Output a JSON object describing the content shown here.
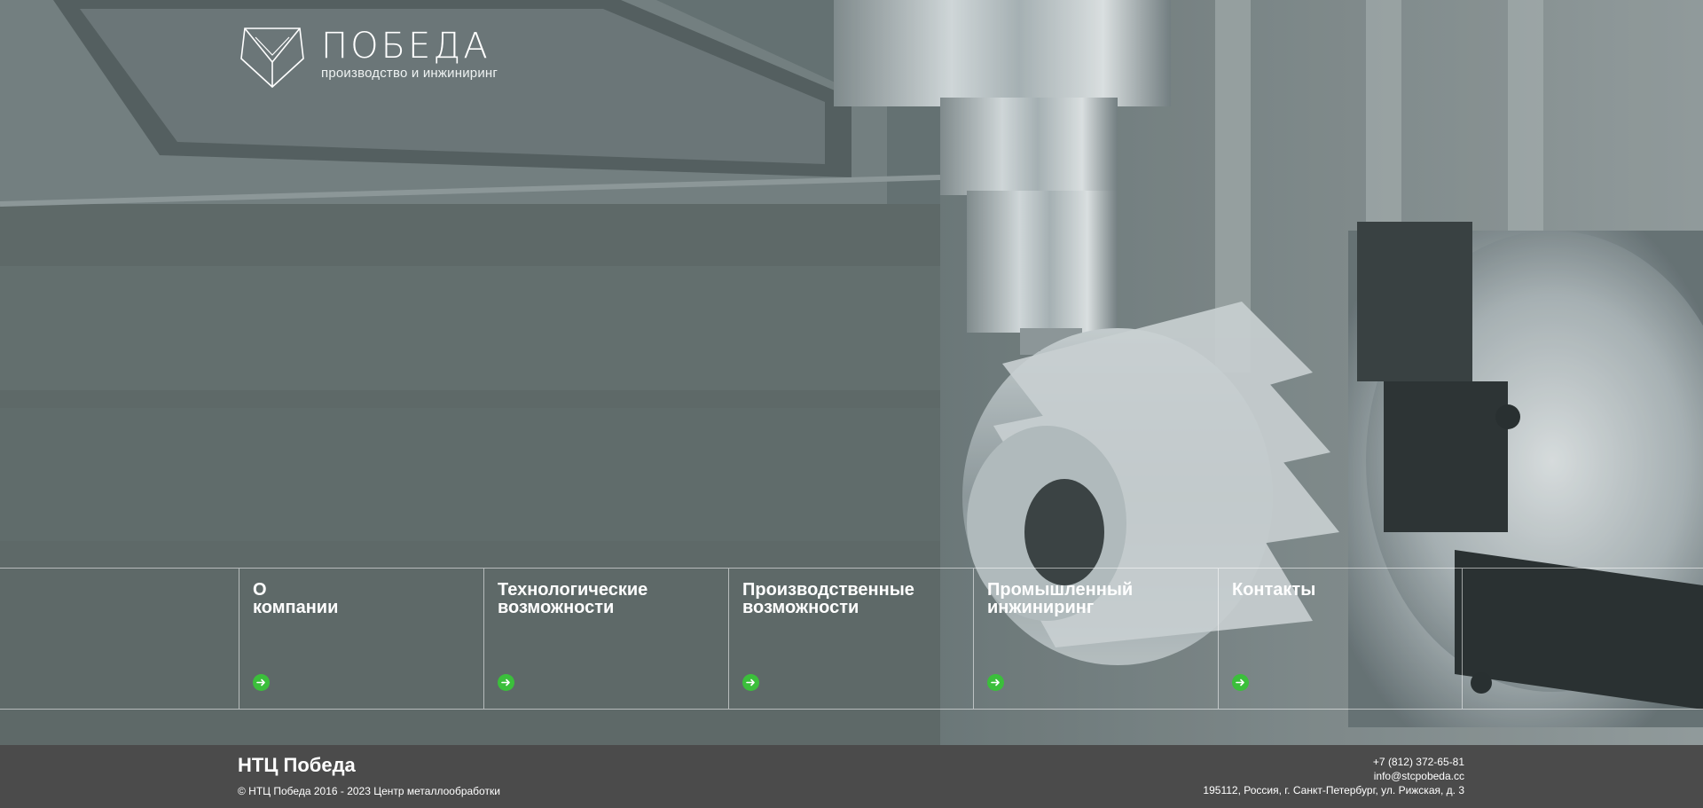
{
  "brand": {
    "logo_name": "ПОБЕДА",
    "tagline": "производство и инжиниринг",
    "logo_icon": "shield-logo-icon"
  },
  "nav": {
    "items": [
      {
        "label": "О\nкомпании",
        "icon": "arrow-right-icon"
      },
      {
        "label": "Технологические\nвозможности",
        "icon": "arrow-right-icon"
      },
      {
        "label": "Производственные\nвозможности",
        "icon": "arrow-right-icon"
      },
      {
        "label": "Промышленный\nинжиниринг",
        "icon": "arrow-right-icon"
      },
      {
        "label": "Контакты",
        "icon": "arrow-right-icon"
      }
    ],
    "accent_color": "#3bbf3b"
  },
  "footer": {
    "company": "НТЦ Победа",
    "copyright": "© НТЦ Победа 2016 - 2023 Центр металлообработки",
    "phone": "+7 (812) 372-65-81",
    "email": "info@stcpobeda.cc",
    "address": "195112, Россия, г. Санкт-Петербург, ул. Рижская, д. 3"
  }
}
